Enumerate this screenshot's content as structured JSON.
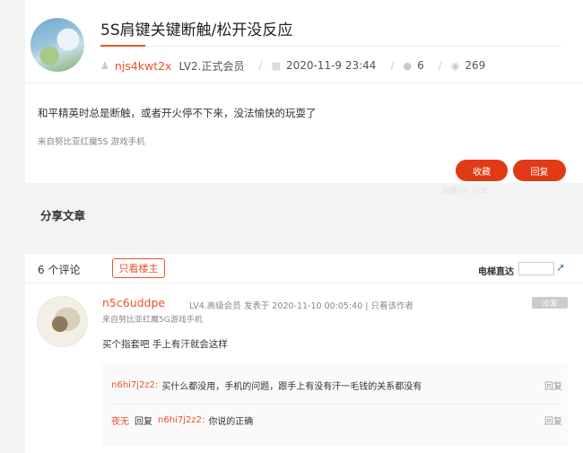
{
  "post": {
    "title": "5S肩键关键断触/松开没反应",
    "author": "njs4kwt2x",
    "level": "LV2.正式会员",
    "datetime": "2020-11-9 23:44",
    "replies": "6",
    "views": "269",
    "content": "和平精英时总是断触，或者开火停不下来，没法愉快的玩耍了",
    "source": "来自努比亚红魔5S 游戏手机",
    "collect_label": "收藏",
    "reply_label": "回复",
    "ghost_text": "收藏(0) 分享"
  },
  "share": {
    "title": "分享文章"
  },
  "comments": {
    "count_label": "6 个评论",
    "only_host_label": "只看楼主",
    "jump_label": "电梯直达",
    "items": [
      {
        "user": "n5c6uddpe",
        "meta": "LV4.高级会员  发表于 2020-11-10 00:05:40  |  只看该作者",
        "badge": "沙发",
        "source": "来自努比亚红魔5G游戏手机",
        "text": "买个指套吧  手上有汗就会这样",
        "replies": [
          {
            "user": "n6hi7j2z2:",
            "text": "买什么都没用，手机的问题，跟手上有没有汗一毛钱的关系都没有",
            "action": "回复"
          },
          {
            "user": "夜无",
            "mid": "回复",
            "user2": "n6hi7j2z2:",
            "text": "你说的正确",
            "action": "回复"
          }
        ]
      }
    ]
  }
}
